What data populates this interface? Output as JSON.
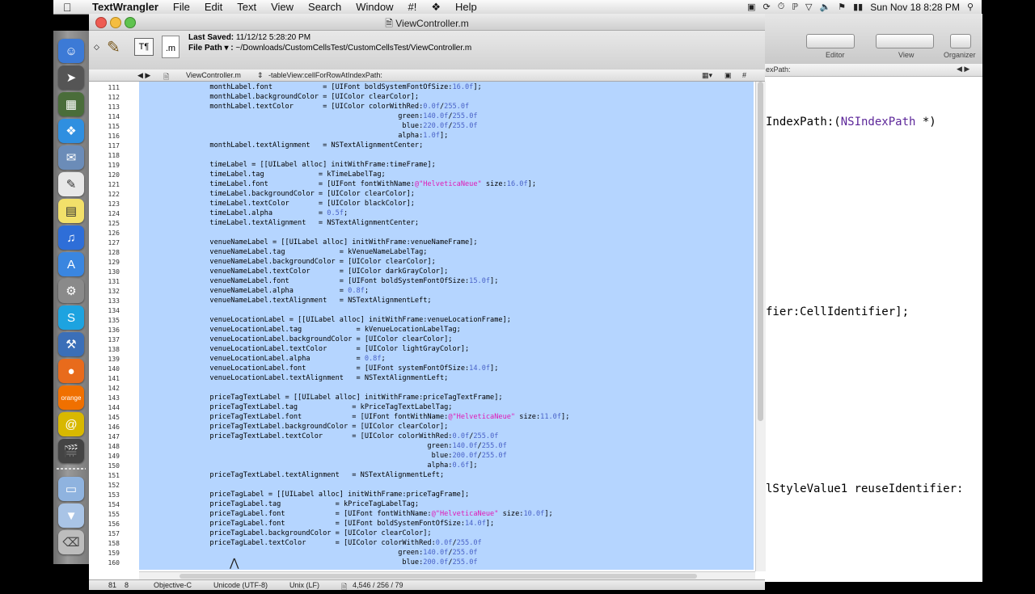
{
  "menubar": {
    "app_name": "TextWrangler",
    "menus": [
      "File",
      "Edit",
      "Text",
      "View",
      "Search",
      "Window",
      "#!",
      "Help"
    ],
    "clock": "Sun Nov 18  8:28 PM"
  },
  "window": {
    "title": "ViewController.m",
    "last_saved_label": "Last Saved:",
    "last_saved_value": "11/12/12 5:28:20 PM",
    "file_path_label": "File Path ▾ :",
    "file_path_value": "~/Downloads/CustomCellsTest/CustomCellsTest/ViewController.m",
    "nav_file": "ViewController.m",
    "nav_function": "-tableView:cellForRowAtIndexPath:",
    "nav_hash": "#"
  },
  "lines": [
    {
      "n": "111",
      "t": "        monthLabel.font            = [UIFont boldSystemFontOfSize:16.0f];"
    },
    {
      "n": "112",
      "t": "        monthLabel.backgroundColor = [UIColor clearColor];"
    },
    {
      "n": "113",
      "t": "        monthLabel.textColor       = [UIColor colorWithRed:0.0f/255.0f"
    },
    {
      "n": "114",
      "t": "                                                     green:140.0f/255.0f"
    },
    {
      "n": "115",
      "t": "                                                      blue:220.0f/255.0f"
    },
    {
      "n": "116",
      "t": "                                                     alpha:1.0f];"
    },
    {
      "n": "117",
      "t": "        monthLabel.textAlignment   = NSTextAlignmentCenter;"
    },
    {
      "n": "118",
      "t": ""
    },
    {
      "n": "119",
      "t": "        timeLabel = [[UILabel alloc] initWithFrame:timeFrame];"
    },
    {
      "n": "120",
      "t": "        timeLabel.tag             = kTimeLabelTag;"
    },
    {
      "n": "121",
      "t": "        timeLabel.font            = [UIFont fontWithName:@\"HelveticaNeue\" size:16.0f];"
    },
    {
      "n": "122",
      "t": "        timeLabel.backgroundColor = [UIColor clearColor];"
    },
    {
      "n": "123",
      "t": "        timeLabel.textColor       = [UIColor blackColor];"
    },
    {
      "n": "124",
      "t": "        timeLabel.alpha           = 0.5f;"
    },
    {
      "n": "125",
      "t": "        timeLabel.textAlignment   = NSTextAlignmentCenter;"
    },
    {
      "n": "126",
      "t": ""
    },
    {
      "n": "127",
      "t": "        venueNameLabel = [[UILabel alloc] initWithFrame:venueNameFrame];"
    },
    {
      "n": "128",
      "t": "        venueNameLabel.tag             = kVenueNameLabelTag;"
    },
    {
      "n": "129",
      "t": "        venueNameLabel.backgroundColor = [UIColor clearColor];"
    },
    {
      "n": "130",
      "t": "        venueNameLabel.textColor       = [UIColor darkGrayColor];"
    },
    {
      "n": "131",
      "t": "        venueNameLabel.font            = [UIFont boldSystemFontOfSize:15.0f];"
    },
    {
      "n": "132",
      "t": "        venueNameLabel.alpha           = 0.8f;"
    },
    {
      "n": "133",
      "t": "        venueNameLabel.textAlignment   = NSTextAlignmentLeft;"
    },
    {
      "n": "134",
      "t": ""
    },
    {
      "n": "135",
      "t": "        venueLocationLabel = [[UILabel alloc] initWithFrame:venueLocationFrame];"
    },
    {
      "n": "136",
      "t": "        venueLocationLabel.tag             = kVenueLocationLabelTag;"
    },
    {
      "n": "137",
      "t": "        venueLocationLabel.backgroundColor = [UIColor clearColor];"
    },
    {
      "n": "138",
      "t": "        venueLocationLabel.textColor       = [UIColor lightGrayColor];"
    },
    {
      "n": "139",
      "t": "        venueLocationLabel.alpha           = 0.8f;"
    },
    {
      "n": "140",
      "t": "        venueLocationLabel.font            = [UIFont systemFontOfSize:14.0f];"
    },
    {
      "n": "141",
      "t": "        venueLocationLabel.textAlignment   = NSTextAlignmentLeft;"
    },
    {
      "n": "142",
      "t": ""
    },
    {
      "n": "143",
      "t": "        priceTagTextLabel = [[UILabel alloc] initWithFrame:priceTagTextFrame];"
    },
    {
      "n": "144",
      "t": "        priceTagTextLabel.tag             = kPriceTagTextLabelTag;"
    },
    {
      "n": "145",
      "t": "        priceTagTextLabel.font            = [UIFont fontWithName:@\"HelveticaNeue\" size:11.0f];"
    },
    {
      "n": "146",
      "t": "        priceTagTextLabel.backgroundColor = [UIColor clearColor];"
    },
    {
      "n": "147",
      "t": "        priceTagTextLabel.textColor       = [UIColor colorWithRed:0.0f/255.0f"
    },
    {
      "n": "148",
      "t": "                                                            green:140.0f/255.0f"
    },
    {
      "n": "149",
      "t": "                                                             blue:200.0f/255.0f"
    },
    {
      "n": "150",
      "t": "                                                            alpha:0.6f];"
    },
    {
      "n": "151",
      "t": "        priceTagTextLabel.textAlignment   = NSTextAlignmentLeft;"
    },
    {
      "n": "152",
      "t": ""
    },
    {
      "n": "153",
      "t": "        priceTagLabel = [[UILabel alloc] initWithFrame:priceTagFrame];"
    },
    {
      "n": "154",
      "t": "        priceTagLabel.tag             = kPriceTagLabelTag;"
    },
    {
      "n": "155",
      "t": "        priceTagLabel.font            = [UIFont fontWithName:@\"HelveticaNeue\" size:10.0f];"
    },
    {
      "n": "156",
      "t": "        priceTagLabel.font            = [UIFont boldSystemFontOfSize:14.0f];"
    },
    {
      "n": "157",
      "t": "        priceTagLabel.backgroundColor = [UIColor clearColor];"
    },
    {
      "n": "158",
      "t": "        priceTagLabel.textColor       = [UIColor colorWithRed:0.0f/255.0f"
    },
    {
      "n": "159",
      "t": "                                                     green:140.0f/255.0f"
    },
    {
      "n": "160",
      "t": "                                                      blue:200.0f/255.0f"
    }
  ],
  "status": {
    "line": "81",
    "col": "8",
    "language": "Objective-C",
    "encoding": "Unicode (UTF-8)",
    "line_endings": "Unix (LF)",
    "counts": "4,546 / 256 / 79"
  },
  "xcode": {
    "toolbar_labels": [
      "Editor",
      "View",
      "Organizer"
    ],
    "path_fragment": "exPath:",
    "code": [
      {
        "pre": "IndexPath:(",
        "kw": "NSIndexPath",
        "post": " *)"
      },
      {
        "pre": "fier:CellIdentifier];",
        "kw": "",
        "post": ""
      },
      {
        "pre": "lStyleValue1 reuseIdentifier:",
        "kw": "",
        "post": ""
      }
    ]
  },
  "colors": {
    "selection": "#b5d5ff",
    "number": "#4a63c8",
    "string": "#e01ab6",
    "keyword": "#5c2699"
  }
}
